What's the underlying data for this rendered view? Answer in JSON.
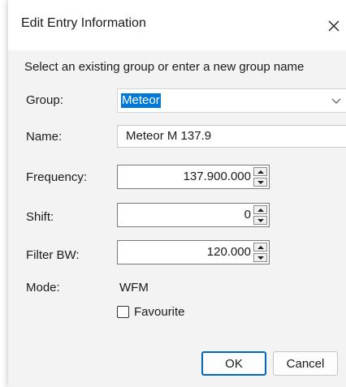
{
  "window": {
    "title": "Edit Entry Information"
  },
  "prompt": "Select an existing group or enter a new group name",
  "fields": {
    "group": {
      "label": "Group:",
      "value": "Meteor"
    },
    "name": {
      "label": "Name:",
      "value": "Meteor M 137.9"
    },
    "frequency": {
      "label": "Frequency:",
      "value": "137.900.000"
    },
    "shift": {
      "label": "Shift:",
      "value": "0"
    },
    "filter_bw": {
      "label": "Filter BW:",
      "value": "120.000"
    },
    "mode": {
      "label": "Mode:",
      "value": "WFM"
    }
  },
  "favourite": {
    "label": "Favourite",
    "checked": false
  },
  "buttons": {
    "ok": "OK",
    "cancel": "Cancel"
  },
  "colors": {
    "accent": "#0078d7",
    "default_button_border": "#0067c0",
    "dialog_bg": "#f3f3f3"
  }
}
